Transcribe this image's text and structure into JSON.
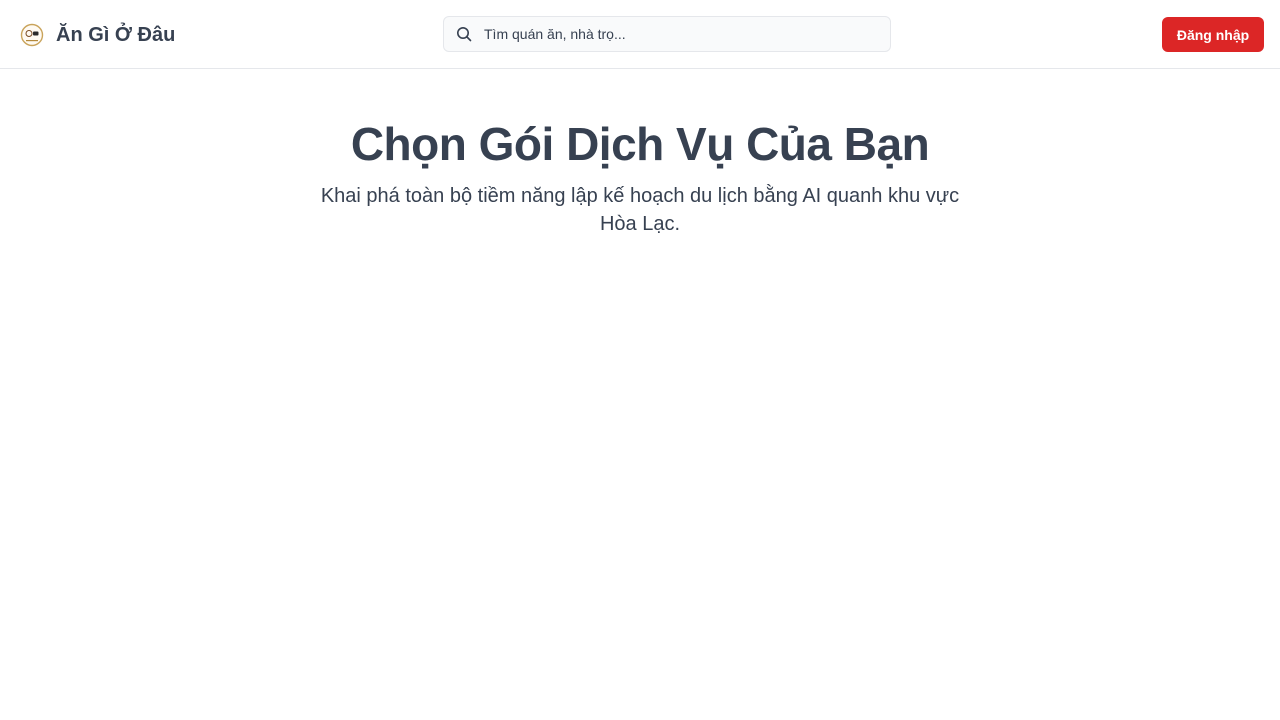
{
  "header": {
    "brand_name": "Ăn Gì Ở Đâu",
    "logo_icon": "restaurant-logo-icon",
    "search": {
      "placeholder": "Tìm quán ăn, nhà trọ...",
      "value": "",
      "icon": "search-icon"
    },
    "login_label": "Đăng nhập"
  },
  "hero": {
    "title": "Chọn Gói Dịch Vụ Của Bạn",
    "subtitle": "Khai phá toàn bộ tiềm năng lập kế hoạch du lịch bằng AI quanh khu vực Hòa Lạc."
  },
  "colors": {
    "accent": "#dc2626",
    "text": "#374151",
    "border": "#e5e7eb",
    "search_bg": "#f9fafb"
  }
}
